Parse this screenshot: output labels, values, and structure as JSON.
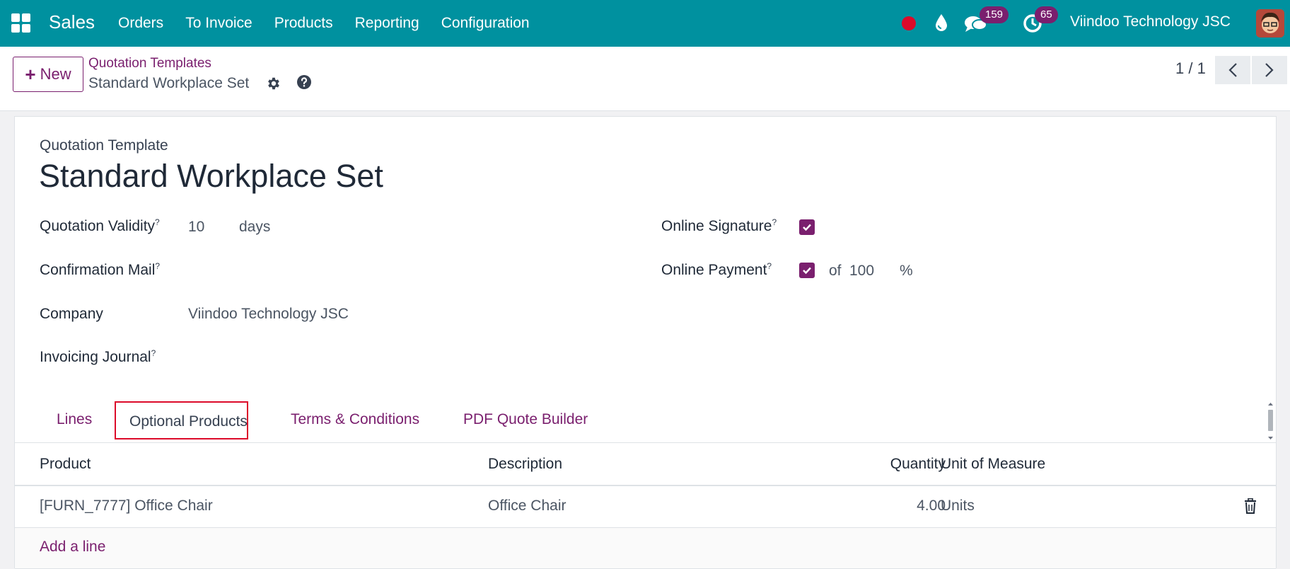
{
  "navbar": {
    "app_name": "Sales",
    "menu": [
      "Orders",
      "To Invoice",
      "Products",
      "Reporting",
      "Configuration"
    ],
    "messages_count": "159",
    "activities_count": "65",
    "company": "Viindoo Technology JSC",
    "icons": [
      "apps-icon",
      "record-icon",
      "drop-icon",
      "chat-icon",
      "clock-icon",
      "avatar"
    ]
  },
  "control_panel": {
    "new_label": "New",
    "breadcrumb_parent": "Quotation Templates",
    "breadcrumb_current": "Standard Workplace Set",
    "pager": "1 / 1"
  },
  "form": {
    "doc_type": "Quotation Template",
    "title": "Standard Workplace Set",
    "fields": {
      "validity_label": "Quotation Validity",
      "validity_value": "10",
      "validity_unit": "days",
      "confirmation_mail_label": "Confirmation Mail",
      "company_label": "Company",
      "company_value": "Viindoo Technology JSC",
      "invoicing_journal_label": "Invoicing Journal",
      "online_signature_label": "Online Signature",
      "online_signature_checked": true,
      "online_payment_label": "Online Payment",
      "online_payment_checked": true,
      "payment_prefix": "of",
      "payment_value": "100",
      "payment_unit": "%"
    },
    "help_mark": "?"
  },
  "tabs": {
    "items": [
      "Lines",
      "Optional Products",
      "Terms & Conditions",
      "PDF Quote Builder"
    ],
    "active": "Optional Products"
  },
  "table": {
    "headers": [
      "Product",
      "Description",
      "Quantity",
      "Unit of Measure"
    ],
    "rows": [
      {
        "product": "[FURN_7777] Office Chair",
        "description": "Office Chair",
        "quantity": "4.00",
        "uom": "Units"
      }
    ],
    "add_line": "Add a line"
  },
  "colors": {
    "navbar": "#00919f",
    "accent": "#7a1f6e",
    "highlight": "#dc0a2a",
    "record": "#dc0a2a"
  }
}
